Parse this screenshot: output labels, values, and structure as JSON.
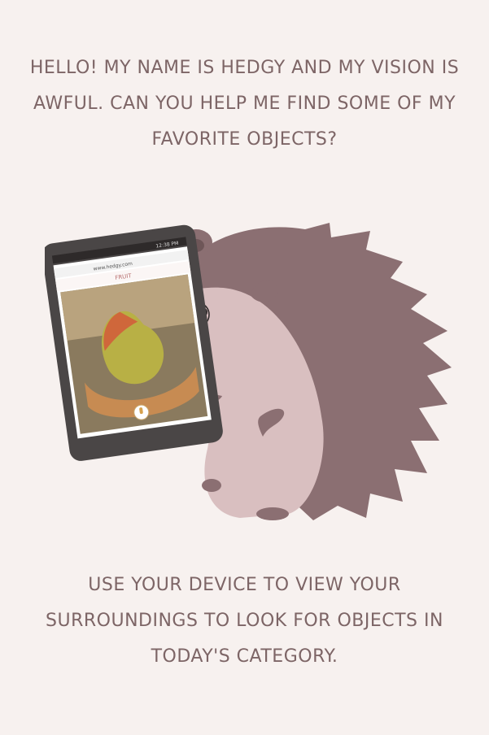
{
  "intro": {
    "text": "HELLO! MY NAME IS HEDGY AND MY VISION IS AWFUL. CAN YOU HELP ME FIND SOME OF MY FAVORITE OBJECTS?"
  },
  "phone": {
    "status_time": "12:38 PM",
    "url": "www.hedgy.com",
    "category_label": "FRUIT"
  },
  "instructions": {
    "text": "USE YOUR DEVICE TO VIEW YOUR SURROUNDINGS TO LOOK FOR OBJECTS IN TODAY'S CATEGORY."
  },
  "colors": {
    "background": "#f7f1ef",
    "text": "#7d6566",
    "spines": "#8b6f72",
    "hedgehog_body": "#d9bfc0",
    "phone": "#4a4646"
  }
}
